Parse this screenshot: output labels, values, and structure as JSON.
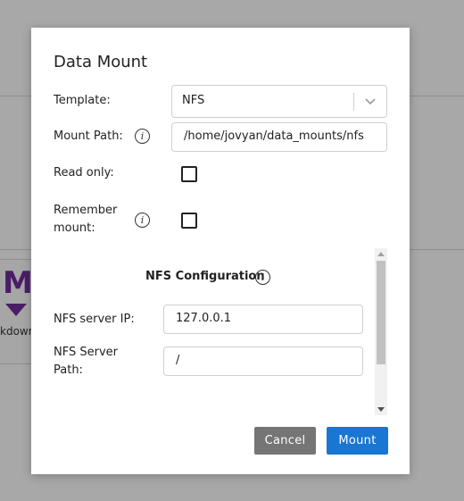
{
  "background": {
    "card_letter": "M",
    "card_label": "kdown"
  },
  "modal": {
    "title": "Data Mount",
    "template": {
      "label": "Template:",
      "value": "NFS"
    },
    "mount_path": {
      "label": "Mount Path:",
      "value": "/home/jovyan/data_mounts/nfs"
    },
    "read_only": {
      "label": "Read only:",
      "checked": false
    },
    "remember_mount": {
      "label_line1": "Remember",
      "label_line2": "mount:",
      "checked": false
    },
    "nfs_config": {
      "title": "NFS Configuration",
      "server_ip": {
        "label": "NFS server IP:",
        "value": "127.0.0.1"
      },
      "server_path": {
        "label_line1": "NFS Server",
        "label_line2": "Path:",
        "value": "/"
      }
    },
    "buttons": {
      "cancel": "Cancel",
      "mount": "Mount"
    }
  },
  "colors": {
    "primary": "#1976d2",
    "secondary": "#757575",
    "overlay": "#a8a8a8",
    "brand_purple": "#4a1d66"
  }
}
